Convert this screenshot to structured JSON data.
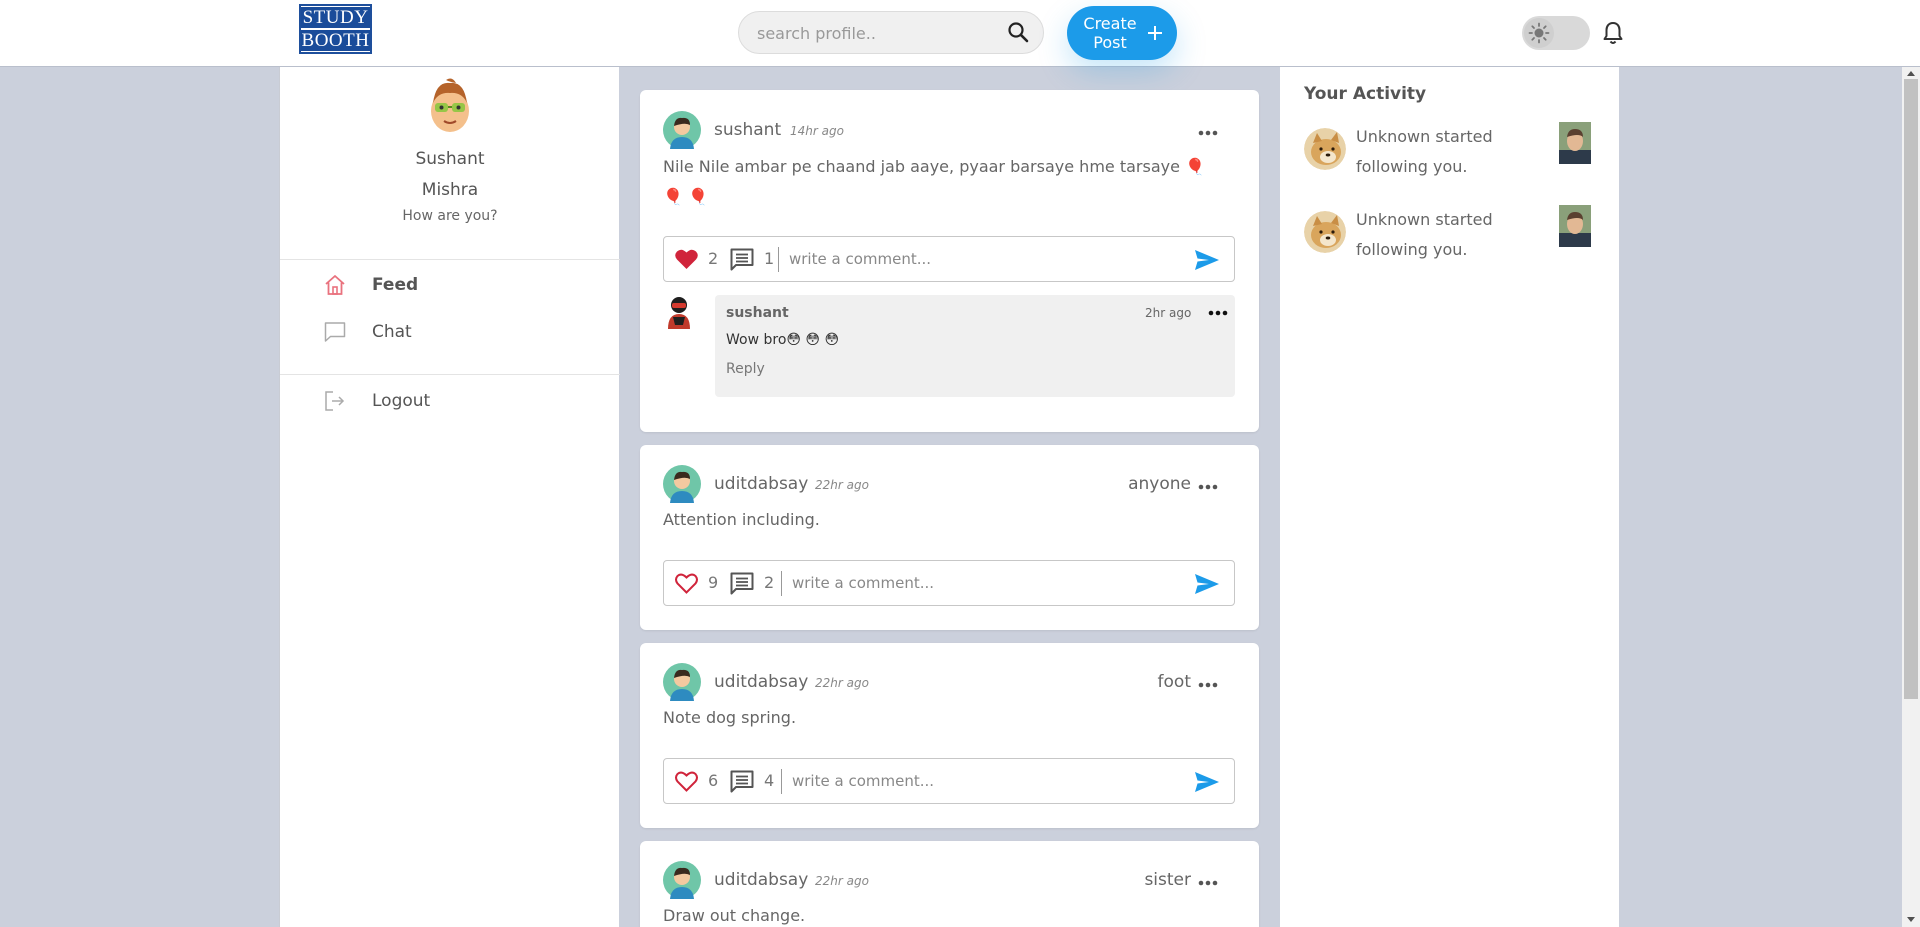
{
  "header": {
    "logo_line1": "STUDY",
    "logo_line2": "BOOTH",
    "search_placeholder": "search profile..",
    "create_post_label": "Create Post"
  },
  "profile": {
    "first_name": "Sushant",
    "last_name": "Mishra",
    "status": "How are you?"
  },
  "nav": {
    "feed": "Feed",
    "chat": "Chat",
    "logout": "Logout"
  },
  "comment_placeholder": "write a comment...",
  "posts": [
    {
      "user": "sushant",
      "time": "14hr ago",
      "tag": "",
      "text": "Nile Nile ambar pe chaand jab aaye, pyaar barsaye hme tarsaye 🎈 🎈 🎈",
      "likes": "2",
      "comments": "1",
      "liked": true,
      "reply": {
        "user": "sushant",
        "time": "2hr ago",
        "text": "Wow bro😳 😳 😳",
        "reply_label": "Reply"
      }
    },
    {
      "user": "uditdabsay",
      "time": "22hr ago",
      "tag": "anyone",
      "text": "Attention including.",
      "likes": "9",
      "comments": "2",
      "liked": false
    },
    {
      "user": "uditdabsay",
      "time": "22hr ago",
      "tag": "foot",
      "text": "Note dog spring.",
      "likes": "6",
      "comments": "4",
      "liked": false
    },
    {
      "user": "uditdabsay",
      "time": "22hr ago",
      "tag": "sister",
      "text": "Draw out change."
    }
  ],
  "activity": {
    "title": "Your Activity",
    "items": [
      {
        "text": "Unknown started following you."
      },
      {
        "text": "Unknown started following you."
      }
    ]
  },
  "colors": {
    "accent": "#1c9be9",
    "like_red": "#d0243b",
    "background": "#cbd0dc",
    "logo_blue": "#1a4c9a"
  }
}
